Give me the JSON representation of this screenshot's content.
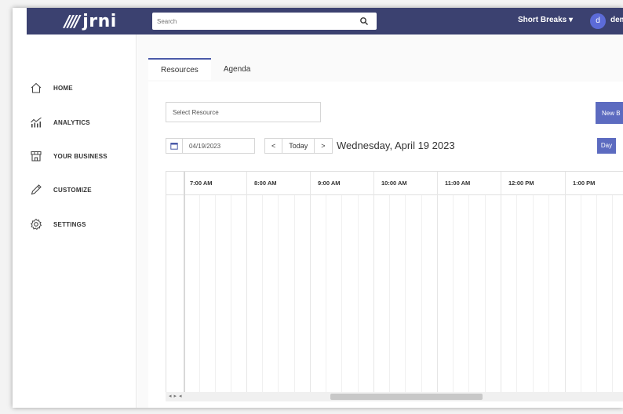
{
  "brand": {
    "logo_text": "jrni",
    "logo_mark": "////"
  },
  "header": {
    "search_placeholder": "Search",
    "company_menu": "Short Breaks ▾",
    "avatar_initial": "d",
    "user_name": "demo@"
  },
  "sidebar": {
    "items": [
      {
        "label": "HOME",
        "icon": "home-icon"
      },
      {
        "label": "ANALYTICS",
        "icon": "analytics-icon"
      },
      {
        "label": "YOUR BUSINESS",
        "icon": "storefront-icon"
      },
      {
        "label": "CUSTOMIZE",
        "icon": "pencil-icon"
      },
      {
        "label": "SETTINGS",
        "icon": "gear-icon"
      }
    ]
  },
  "tabs": [
    {
      "label": "Resources",
      "active": true
    },
    {
      "label": "Agenda",
      "active": false
    }
  ],
  "toolbar": {
    "select_resource_placeholder": "Select Resource",
    "new_booking_label": "New B",
    "date_value": "04/19/2023",
    "prev_label": "<",
    "today_label": "Today",
    "next_label": ">",
    "date_title": "Wednesday, April 19 2023",
    "view_day_label": "Day"
  },
  "calendar": {
    "hours": [
      "7:00 AM",
      "8:00 AM",
      "9:00 AM",
      "10:00 AM",
      "11:00 AM",
      "12:00 PM",
      "1:00 PM"
    ]
  },
  "colors": {
    "topbar": "#3b4170",
    "accent": "#5c6bc0",
    "avatar": "#5c6bd8"
  }
}
